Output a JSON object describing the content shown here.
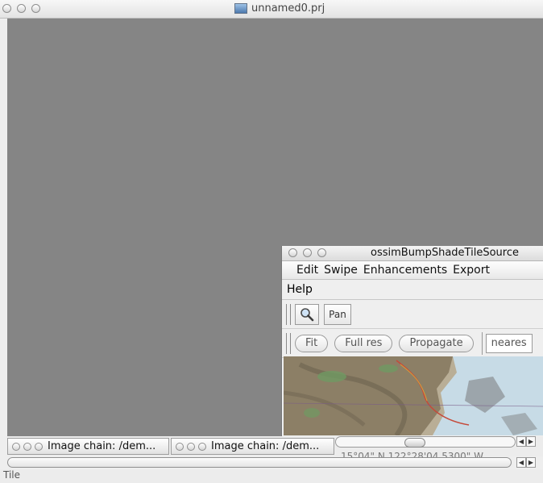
{
  "main_window": {
    "title": "unnamed0.prj"
  },
  "sub_window": {
    "title": "ossimBumpShadeTileSource",
    "menu": [
      "Edit",
      "Swipe",
      "Enhancements",
      "Export"
    ],
    "help_label": "Help",
    "tools": {
      "pan_label": "Pan"
    },
    "buttons": {
      "fit": "Fit",
      "full_res": "Full res",
      "propagate": "Propagate"
    },
    "resampler_value": "neares"
  },
  "minimized_windows": [
    {
      "label": "Image chain: /dem..."
    },
    {
      "label": "Image chain: /dem..."
    }
  ],
  "coordinate_readout": "15°04\" N 122°28'04.5300\" W",
  "status_text": "Tile",
  "icons": [
    "search-icon",
    "document-icon",
    "scroll-left-icon",
    "scroll-right-icon"
  ],
  "colors": {
    "desktop": "#858585",
    "window_chrome": "#ececec"
  }
}
